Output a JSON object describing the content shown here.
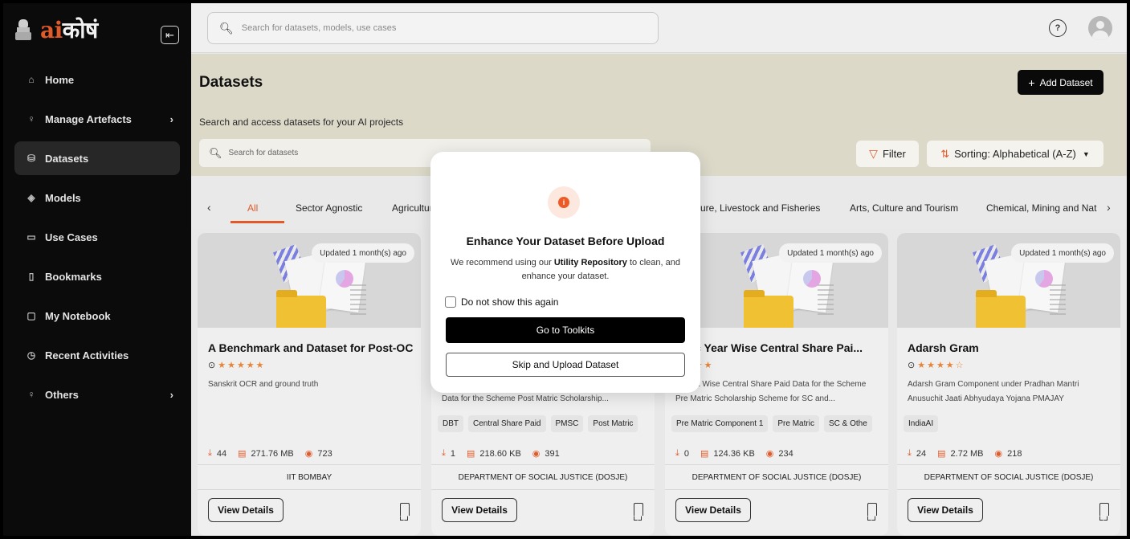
{
  "sidebar": {
    "brand_ai": "ai",
    "brand_kosh": "कोषं",
    "items": [
      {
        "label": "Home",
        "icon": "home-icon"
      },
      {
        "label": "Manage Artefacts",
        "icon": "lightbulb-icon"
      },
      {
        "label": "Datasets",
        "icon": "database-icon",
        "active": true
      },
      {
        "label": "Models",
        "icon": "cube-icon"
      },
      {
        "label": "Use Cases",
        "icon": "briefcase-icon"
      },
      {
        "label": "Bookmarks",
        "icon": "bookmark-icon"
      },
      {
        "label": "My Notebook",
        "icon": "notebook-icon"
      },
      {
        "label": "Recent Activities",
        "icon": "clock-icon"
      },
      {
        "label": "Others",
        "icon": "lightbulb-icon"
      }
    ]
  },
  "topbar": {
    "search_placeholder": "Search for datasets, models, use cases"
  },
  "page": {
    "title": "Datasets",
    "add_label": "Add Dataset",
    "subtitle": "Search and access datasets for your AI projects",
    "search_placeholder": "Search for datasets",
    "filter_label": "Filter",
    "sort_label": "Sorting: Alphabetical (A-Z)"
  },
  "tabs": [
    "All",
    "Sector Agnostic",
    "Agricultur",
    "ure, Livestock and Fisheries",
    "Arts, Culture and Tourism",
    "Chemical, Mining and Nat"
  ],
  "cards": [
    {
      "updated": "Updated 1 month(s) ago",
      "title": "A Benchmark and Dataset for Post-OC...",
      "desc": "Sanskrit OCR and ground truth",
      "tags": [],
      "downloads": "44",
      "size": "271.76 MB",
      "views": "723",
      "org": "IIT BOMBAY",
      "view_label": "View Details"
    },
    {
      "updated": "",
      "title": "",
      "desc": "Data for the Scheme Post Matric Scholarship...",
      "tags": [
        "DBT",
        "Central Share Paid",
        "PMSC",
        "Post Matric"
      ],
      "downloads": "1",
      "size": "218.60 KB",
      "views": "391",
      "org": "DEPARTMENT OF SOCIAL JUSTICE (DOSJE)",
      "view_label": "View Details"
    },
    {
      "updated": "Updated 1 month(s) ago",
      "title": "emic Year Wise Central Share Pai...",
      "desc": "District Wise Central Share Paid Data for the Scheme Pre Matric Scholarship Scheme for SC and...",
      "tags": [
        "Pre Matric Component 1",
        "Pre Matric",
        "SC & Othe"
      ],
      "downloads": "0",
      "size": "124.36 KB",
      "views": "234",
      "org": "DEPARTMENT OF SOCIAL JUSTICE (DOSJE)",
      "view_label": "View Details"
    },
    {
      "updated": "Updated 1 month(s) ago",
      "title": "Adarsh Gram",
      "desc": "Adarsh Gram Component under Pradhan Mantri Anusuchit Jaati Abhyudaya Yojana PMAJAY",
      "tags": [
        "IndiaAI"
      ],
      "downloads": "24",
      "size": "2.72 MB",
      "views": "218",
      "org": "DEPARTMENT OF SOCIAL JUSTICE (DOSJE)",
      "view_label": "View Details"
    }
  ],
  "modal": {
    "title": "Enhance Your Dataset Before Upload",
    "body_pre": "We recommend using our ",
    "body_bold": "Utility Repository",
    "body_post": " to clean, and enhance your dataset.",
    "checkbox_label": "Do not show this again",
    "primary_label": "Go to Toolkits",
    "secondary_label": "Skip and Upload Dataset"
  },
  "colors": {
    "accent": "#e05a2a",
    "sidebar_bg": "#0b0b0b",
    "hero_bg": "#dcd9c9"
  }
}
